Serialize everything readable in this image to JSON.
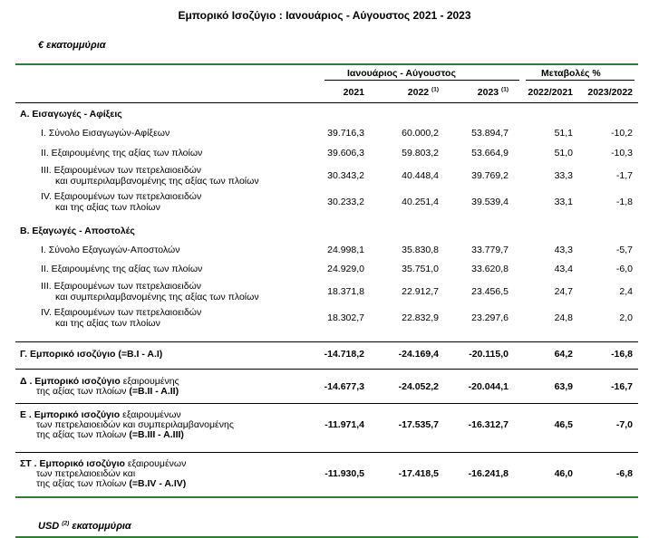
{
  "title": "Εμπορικό Ισοζύγιο : Ιανουάριος - Αύγουστος 2021 - 2023",
  "unit_eur": "€ εκατομμύρια",
  "header": {
    "period_group": "Ιανουάριος - Αύγουστος",
    "change_group": "Μεταβολές %",
    "col_2021": "2021",
    "col_2022": "2022",
    "col_2022_note": "(1)",
    "col_2023": "2023",
    "col_2023_note": "(1)",
    "col_ch1": "2022/2021",
    "col_ch2": "2023/2022"
  },
  "sections": {
    "A": "Α. Εισαγωγές - Αφίξεις",
    "B": "Β. Εξαγωγές - Αποστολές"
  },
  "rows": [
    {
      "l1": "I.   Σύνολο Εισαγωγών-Αφίξεων",
      "l2": "",
      "v": [
        "39.716,3",
        "60.000,2",
        "53.894,7",
        "51,1",
        "-10,2"
      ]
    },
    {
      "l1": "II.   Εξαιρουμένης  της αξίας των πλοίων",
      "l2": "",
      "v": [
        "39.606,3",
        "59.803,2",
        "53.664,9",
        "51,0",
        "-10,3"
      ]
    },
    {
      "l1": "III.  Εξαιρουμένων των πετρελαιοειδών",
      "l2": "και συμπεριλαμβανομένης της αξίας των πλοίων",
      "v": [
        "30.343,2",
        "40.448,4",
        "39.769,2",
        "33,3",
        "-1,7"
      ]
    },
    {
      "l1": "IV.  Εξαιρουμένων των πετρελαιοειδών",
      "l2": "και  της αξίας των πλοίων",
      "v": [
        "30.233,2",
        "40.251,4",
        "39.539,4",
        "33,1",
        "-1,8"
      ]
    },
    {
      "l1": "I.  Σύνολο Εξαγωγών-Αποστολών",
      "l2": "",
      "v": [
        "24.998,1",
        "35.830,8",
        "33.779,7",
        "43,3",
        "-5,7"
      ]
    },
    {
      "l1": "II.  Εξαιρουμένης  της αξίας των πλοίων",
      "l2": "",
      "v": [
        "24.929,0",
        "35.751,0",
        "33.620,8",
        "43,4",
        "-6,0"
      ]
    },
    {
      "l1": "III.  Εξαιρουμένων των πετρελαιοειδών",
      "l2": "και συμπεριλαμβανομένης  της αξίας των πλοίων",
      "v": [
        "18.371,8",
        "22.912,7",
        "23.456,5",
        "24,7",
        "2,4"
      ]
    },
    {
      "l1": "IV.  Εξαιρουμένων των πετρελαιοειδών",
      "l2": "και  της αξίας των πλοίων",
      "v": [
        "18.302,7",
        "22.832,9",
        "23.297,6",
        "24,8",
        "2,0"
      ]
    }
  ],
  "balances": [
    {
      "b1": "Γ. Εμπορικό ισοζύγιο (=B.I - A.I)",
      "n1": "",
      "l2": "",
      "b2": "",
      "l3": "",
      "b3": "",
      "v": [
        "-14.718,2",
        "-24.169,4",
        "-20.115,0",
        "64,2",
        "-16,8"
      ]
    },
    {
      "b1": "Δ . Εμπορικό ισοζύγιο",
      "n1": " εξαιρουμένης",
      "l2": "της αξίας των πλοίων",
      "b2": " (=B.II - A.II)",
      "l3": "",
      "b3": "",
      "v": [
        "-14.677,3",
        "-24.052,2",
        "-20.044,1",
        "63,9",
        "-16,7"
      ]
    },
    {
      "b1": "Ε . Εμπορικό ισοζύγιο",
      "n1": " εξαιρουμένων",
      "l2": "των πετρελαιοειδών και συμπεριλαμβανομένης",
      "b2": "",
      "l3": "της αξίας των πλοίων",
      "b3": " (=B.III - A.III)",
      "v": [
        "-11.971,4",
        "-17.535,7",
        "-16.312,7",
        "46,5",
        "-7,0"
      ]
    },
    {
      "b1": "ΣΤ . Εμπορικό ισοζύγιο",
      "n1": " εξαιρουμένων",
      "l2": "των πετρελαιοειδών και",
      "b2": "",
      "l3": "της αξίας των πλοίων",
      "b3": " (=B.IV - A.IV)",
      "v": [
        "-11.930,5",
        "-17.418,5",
        "-16.241,8",
        "46,0",
        "-6,8"
      ]
    }
  ],
  "footer_unit": {
    "prefix": "USD",
    "note": "(2)",
    "suffix": "εκατομμύρια"
  },
  "colors": {
    "rule": "#2e7d32",
    "text": "#000000"
  }
}
